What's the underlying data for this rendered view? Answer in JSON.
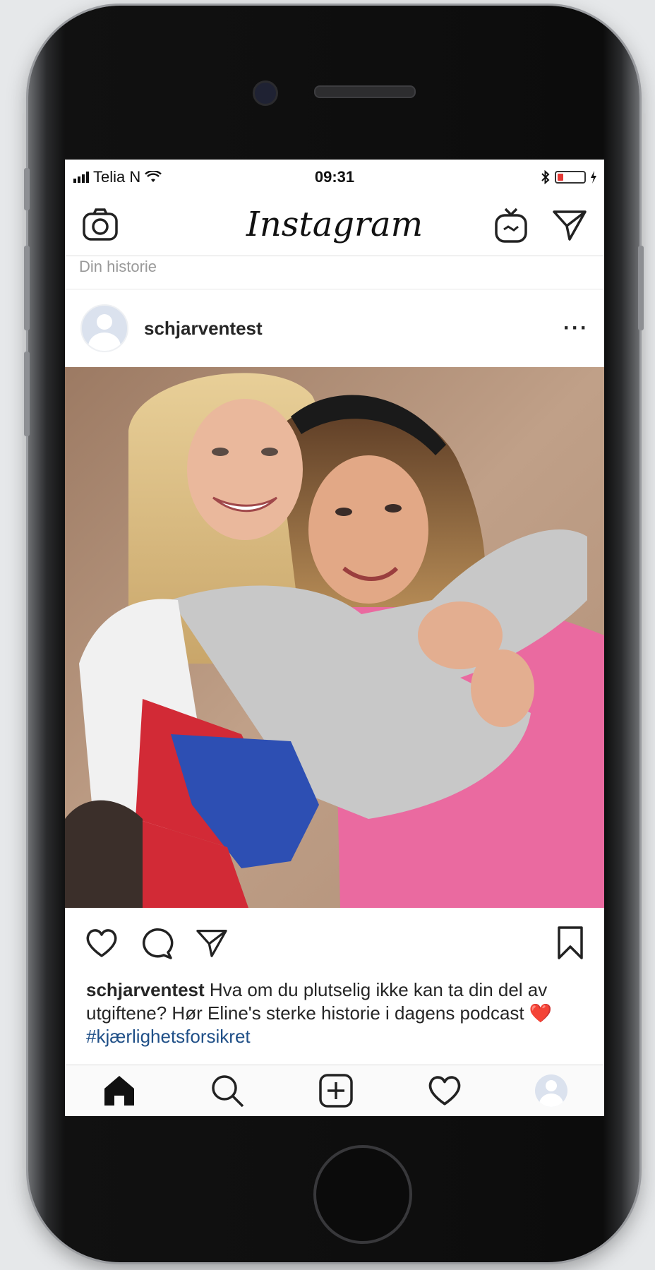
{
  "status": {
    "carrier": "Telia N",
    "time": "09:31"
  },
  "header": {
    "logo": "Instagram",
    "camera_icon": "camera-icon",
    "igtv_icon": "igtv-icon",
    "direct_icon": "direct-message-icon"
  },
  "stories": {
    "label": "Din historie"
  },
  "post": {
    "username": "schjarventest",
    "more_label": "···",
    "caption_user": "schjarventest",
    "caption_text": " Hva om du plutselig ikke kan ta din del av utgiftene? Hør Eline's sterke historie i dagens podcast ",
    "caption_emoji": "❤️",
    "caption_hashtag": "#kjærlighetsforsikret"
  },
  "tabbar": {
    "items": [
      "home-icon",
      "search-icon",
      "add-post-icon",
      "activity-heart-icon",
      "profile-avatar"
    ]
  },
  "colors": {
    "hashtag": "#1f4f87",
    "battery_low": "#e53935"
  }
}
